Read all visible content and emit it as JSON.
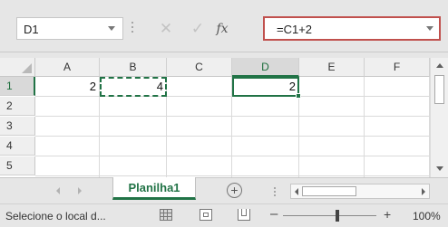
{
  "formula_bar": {
    "name_box": "D1",
    "formula": "=C1+2"
  },
  "grid": {
    "columns": [
      "A",
      "B",
      "C",
      "D",
      "E",
      "F"
    ],
    "rows": [
      "1",
      "2",
      "3",
      "4",
      "5"
    ],
    "active_cell": "D1",
    "copy_marquee_cell": "B1",
    "cells": [
      {
        "ref": "A1",
        "value": "2"
      },
      {
        "ref": "B1",
        "value": "4"
      },
      {
        "ref": "D1",
        "value": "2"
      }
    ]
  },
  "sheet_tabs": {
    "active_tab": "Planilha1"
  },
  "status_bar": {
    "status_text": "Selecione o local d...",
    "zoom_level": "100%"
  },
  "colors": {
    "accent_green": "#217346",
    "formula_box_border": "#c0504d"
  },
  "icons": [
    "name-box-dropdown-icon",
    "cancel-icon",
    "enter-icon",
    "insert-function-icon",
    "formula-expand-icon",
    "select-all-icon",
    "add-sheet-icon",
    "normal-view-icon",
    "page-layout-icon",
    "page-break-preview-icon"
  ]
}
